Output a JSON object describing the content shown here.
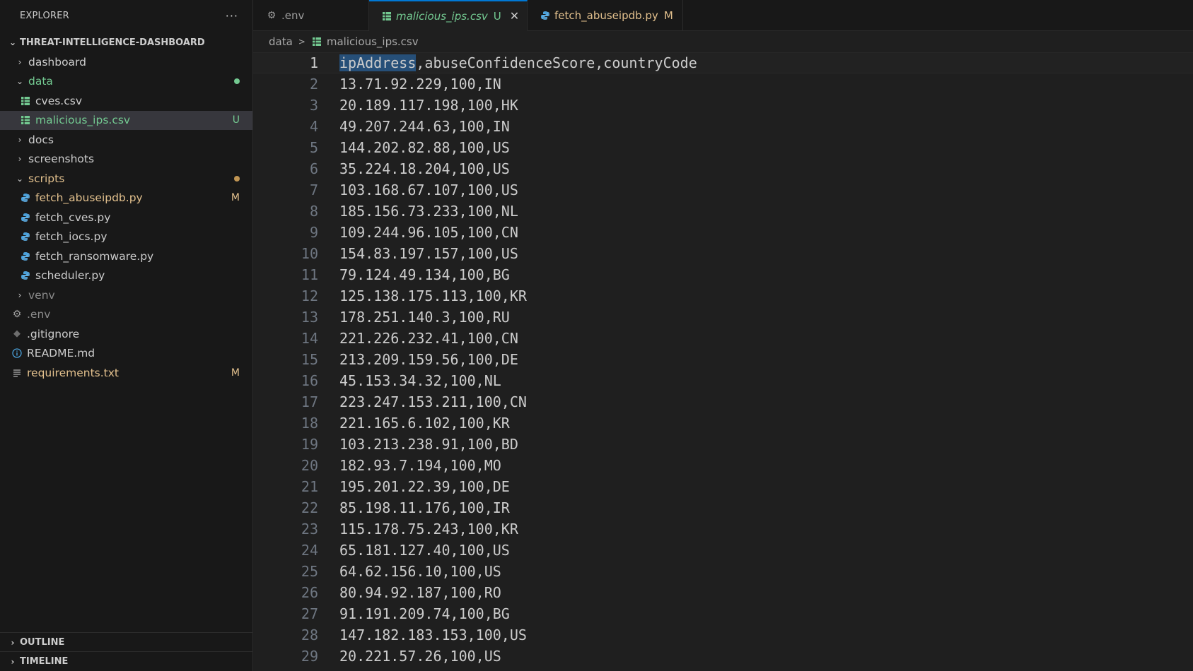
{
  "sidebar": {
    "title": "EXPLORER",
    "more": "···",
    "workspace": "THREAT-INTELLIGENCE-DASHBOARD",
    "items": [
      {
        "name": "dashboard",
        "kind": "folder",
        "state": "collapsed",
        "indent": 1,
        "label": "dashboard"
      },
      {
        "name": "data",
        "kind": "folder",
        "state": "expanded",
        "indent": 1,
        "label": "data",
        "status": "dot",
        "status_color": "#73c991",
        "label_color": "#73c991"
      },
      {
        "name": "cves-csv",
        "kind": "csv",
        "indent": 2,
        "label": "cves.csv"
      },
      {
        "name": "malicious-ips-csv",
        "kind": "csv",
        "indent": 2,
        "label": "malicious_ips.csv",
        "status": "U",
        "status_color": "#73c991",
        "label_color": "#73c991",
        "selected": true
      },
      {
        "name": "docs",
        "kind": "folder",
        "state": "collapsed",
        "indent": 1,
        "label": "docs"
      },
      {
        "name": "screenshots",
        "kind": "folder",
        "state": "collapsed",
        "indent": 1,
        "label": "screenshots"
      },
      {
        "name": "scripts",
        "kind": "folder",
        "state": "expanded",
        "indent": 1,
        "label": "scripts",
        "status": "dot",
        "status_color": "#c09553",
        "label_color": "#e2c08d"
      },
      {
        "name": "fetch-abuseipdb-py",
        "kind": "py",
        "indent": 2,
        "label": "fetch_abuseipdb.py",
        "status": "M",
        "status_color": "#e2c08d",
        "label_color": "#e2c08d"
      },
      {
        "name": "fetch-cves-py",
        "kind": "py",
        "indent": 2,
        "label": "fetch_cves.py"
      },
      {
        "name": "fetch-iocs-py",
        "kind": "py",
        "indent": 2,
        "label": "fetch_iocs.py"
      },
      {
        "name": "fetch-ransomware-py",
        "kind": "py",
        "indent": 2,
        "label": "fetch_ransomware.py"
      },
      {
        "name": "scheduler-py",
        "kind": "py",
        "indent": 2,
        "label": "scheduler.py"
      },
      {
        "name": "venv",
        "kind": "folder",
        "state": "collapsed",
        "indent": 1,
        "label": "venv",
        "label_color": "#8b8b8b"
      },
      {
        "name": "env-file",
        "kind": "gear",
        "indent": 0,
        "label": ".env",
        "label_color": "#8b8b8b"
      },
      {
        "name": "gitignore-file",
        "kind": "git",
        "indent": 0,
        "label": ".gitignore"
      },
      {
        "name": "readme-file",
        "kind": "info",
        "indent": 0,
        "label": "README.md"
      },
      {
        "name": "requirements-file",
        "kind": "lines",
        "indent": 0,
        "label": "requirements.txt",
        "status": "M",
        "status_color": "#e2c08d",
        "label_color": "#e2c08d"
      }
    ],
    "outline": "OUTLINE",
    "timeline": "TIMELINE"
  },
  "tabs": [
    {
      "name": "tab-env",
      "icon": "gear",
      "label": ".env",
      "status": "",
      "active": false
    },
    {
      "name": "tab-malicious-ips",
      "icon": "csv",
      "label": "malicious_ips.csv",
      "status": "U",
      "active": true
    },
    {
      "name": "tab-fetch-abuseipdb",
      "icon": "py",
      "label": "fetch_abuseipdb.py",
      "status": "M",
      "active": false
    }
  ],
  "breadcrumb": {
    "folder": "data",
    "file": "malicious_ips.csv"
  },
  "editor": {
    "header_highlight": "ipAddress",
    "lines": [
      "ipAddress,abuseConfidenceScore,countryCode",
      "13.71.92.229,100,IN",
      "20.189.117.198,100,HK",
      "49.207.244.63,100,IN",
      "144.202.82.88,100,US",
      "35.224.18.204,100,US",
      "103.168.67.107,100,US",
      "185.156.73.233,100,NL",
      "109.244.96.105,100,CN",
      "154.83.197.157,100,US",
      "79.124.49.134,100,BG",
      "125.138.175.113,100,KR",
      "178.251.140.3,100,RU",
      "221.226.232.41,100,CN",
      "213.209.159.56,100,DE",
      "45.153.34.32,100,NL",
      "223.247.153.211,100,CN",
      "221.165.6.102,100,KR",
      "103.213.238.91,100,BD",
      "182.93.7.194,100,MO",
      "195.201.22.39,100,DE",
      "85.198.11.176,100,IR",
      "115.178.75.243,100,KR",
      "65.181.127.40,100,US",
      "64.62.156.10,100,US",
      "80.94.92.187,100,RO",
      "91.191.209.74,100,BG",
      "147.182.183.153,100,US",
      "20.221.57.26,100,US"
    ]
  }
}
